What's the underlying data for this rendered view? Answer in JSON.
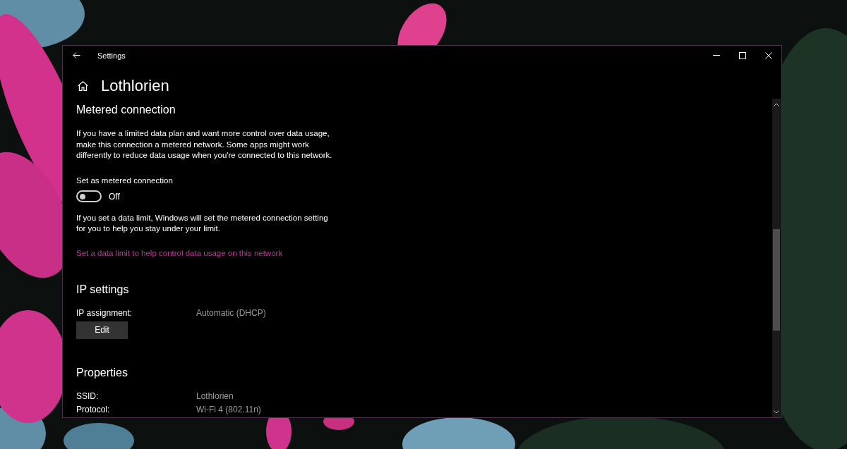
{
  "window": {
    "title": "Settings"
  },
  "page": {
    "title": "Lothlorien"
  },
  "metered_connection": {
    "heading": "Metered connection",
    "description": "If you have a limited data plan and want more control over data usage, make this connection a metered network. Some apps might work differently to reduce data usage when you're connected to this network.",
    "toggle": {
      "label": "Set as metered connection",
      "on": false,
      "state_text": "Off"
    },
    "note": "If you set a data limit, Windows will set the metered connection setting for you to help you stay under your limit.",
    "link": "Set a data limit to help control data usage on this network"
  },
  "ip_settings": {
    "heading": "IP settings",
    "rows": [
      {
        "label": "IP assignment:",
        "value": "Automatic (DHCP)"
      }
    ],
    "button": "Edit"
  },
  "properties": {
    "heading": "Properties",
    "rows": [
      {
        "label": "SSID:",
        "value": "Lothlorien"
      },
      {
        "label": "Protocol:",
        "value": "Wi-Fi 4 (802.11n)"
      }
    ]
  }
}
